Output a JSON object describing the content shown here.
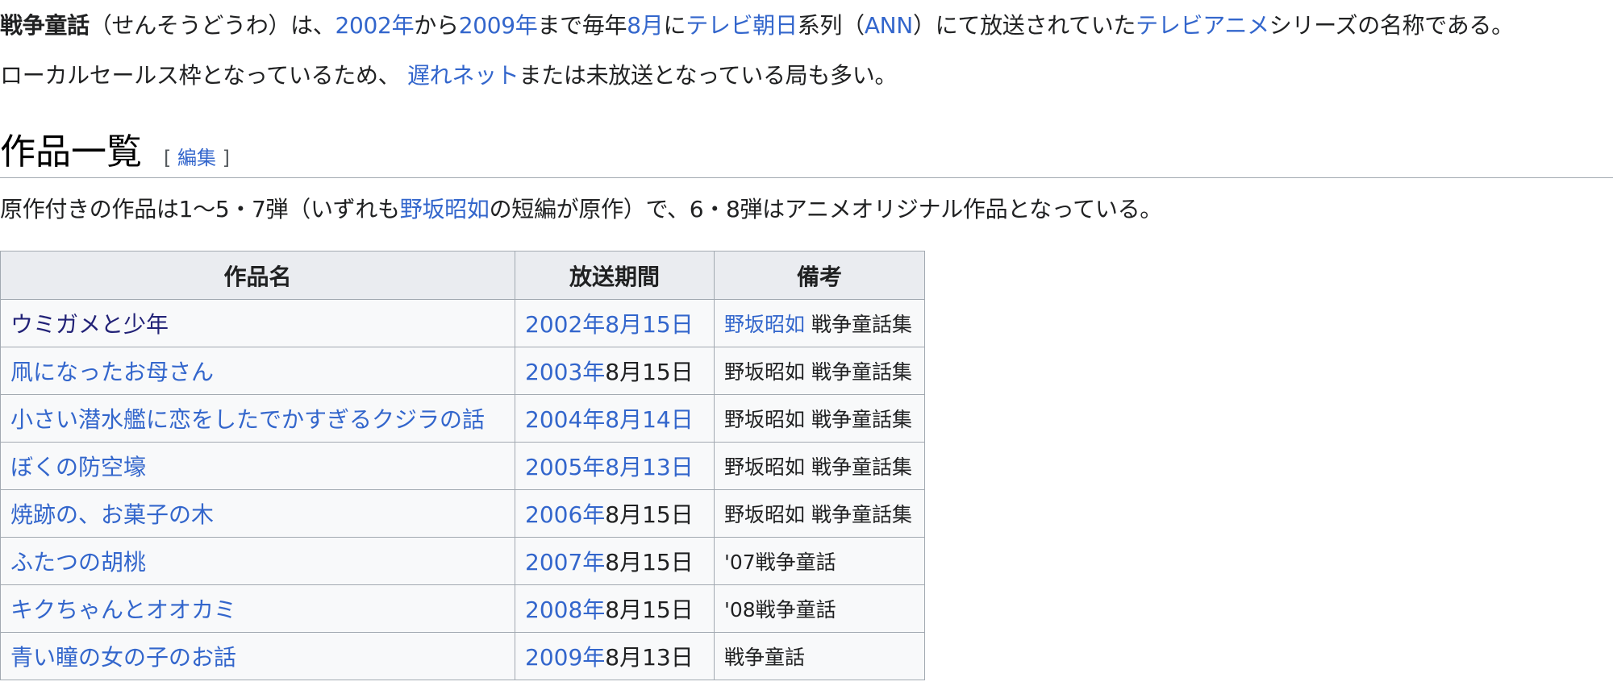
{
  "intro": {
    "p1": [
      {
        "t": "戦争童話",
        "b": true
      },
      {
        "t": "（せんそうどうわ）は、"
      },
      {
        "t": "2002年",
        "l": true
      },
      {
        "t": "から"
      },
      {
        "t": "2009年",
        "l": true
      },
      {
        "t": "まで毎年"
      },
      {
        "t": "8月",
        "l": true
      },
      {
        "t": "に"
      },
      {
        "t": "テレビ朝日",
        "l": true
      },
      {
        "t": "系列（"
      },
      {
        "t": "ANN",
        "l": true
      },
      {
        "t": "）にて放送されていた"
      },
      {
        "t": "テレビアニメ",
        "l": true
      },
      {
        "t": "シリーズの名称である。"
      }
    ],
    "p2": [
      {
        "t": "ローカルセールス枠となっているため、 "
      },
      {
        "t": "遅れネット",
        "l": true
      },
      {
        "t": "または未放送となっている局も多い。"
      }
    ]
  },
  "section": {
    "title": "作品一覧",
    "edit_open": "[ ",
    "edit_label": "編集",
    "edit_close": " ]",
    "desc": [
      {
        "t": "原作付きの作品は1〜5・7弾（いずれも"
      },
      {
        "t": "野坂昭如",
        "l": true
      },
      {
        "t": "の短編が原作）で、6・8弾はアニメオリジナル作品となっている。"
      }
    ]
  },
  "table": {
    "headers": [
      "作品名",
      "放送期間",
      "備考"
    ],
    "rows": [
      {
        "title": "ウミガメと少年",
        "visited": true,
        "date": [
          {
            "t": "2002年8月15日",
            "l": true
          }
        ],
        "note": [
          {
            "t": "野坂昭如",
            "l": true
          },
          {
            "t": " 戦争童話集"
          }
        ]
      },
      {
        "title": "凧になったお母さん",
        "date": [
          {
            "t": "2003年",
            "l": true
          },
          {
            "t": "8月15日"
          }
        ],
        "note": [
          {
            "t": "野坂昭如 戦争童話集"
          }
        ]
      },
      {
        "title": "小さい潜水艦に恋をしたでかすぎるクジラの話",
        "date": [
          {
            "t": "2004年8月14日",
            "l": true
          }
        ],
        "note": [
          {
            "t": "野坂昭如 戦争童話集"
          }
        ]
      },
      {
        "title": "ぼくの防空壕",
        "date": [
          {
            "t": "2005年8月13日",
            "l": true
          }
        ],
        "note": [
          {
            "t": "野坂昭如 戦争童話集"
          }
        ]
      },
      {
        "title": "焼跡の、お菓子の木",
        "date": [
          {
            "t": "2006年",
            "l": true
          },
          {
            "t": "8月15日"
          }
        ],
        "note": [
          {
            "t": "野坂昭如 戦争童話集"
          }
        ]
      },
      {
        "title": "ふたつの胡桃",
        "date": [
          {
            "t": "2007年",
            "l": true
          },
          {
            "t": "8月15日"
          }
        ],
        "note": [
          {
            "t": "'07戦争童話"
          }
        ]
      },
      {
        "title": "キクちゃんとオオカミ",
        "date": [
          {
            "t": "2008年",
            "l": true
          },
          {
            "t": "8月15日"
          }
        ],
        "note": [
          {
            "t": "'08戦争童話"
          }
        ]
      },
      {
        "title": "青い瞳の女の子のお話",
        "date": [
          {
            "t": "2009年",
            "l": true
          },
          {
            "t": "8月13日"
          }
        ],
        "note": [
          {
            "t": "戦争童話"
          }
        ]
      }
    ]
  },
  "colors": {
    "link": "#3366cc",
    "visited_link": "#222277",
    "text": "#202122",
    "table_header_bg": "#eaecf0",
    "table_bg": "#f8f9fa",
    "border": "#a2a9b1"
  }
}
